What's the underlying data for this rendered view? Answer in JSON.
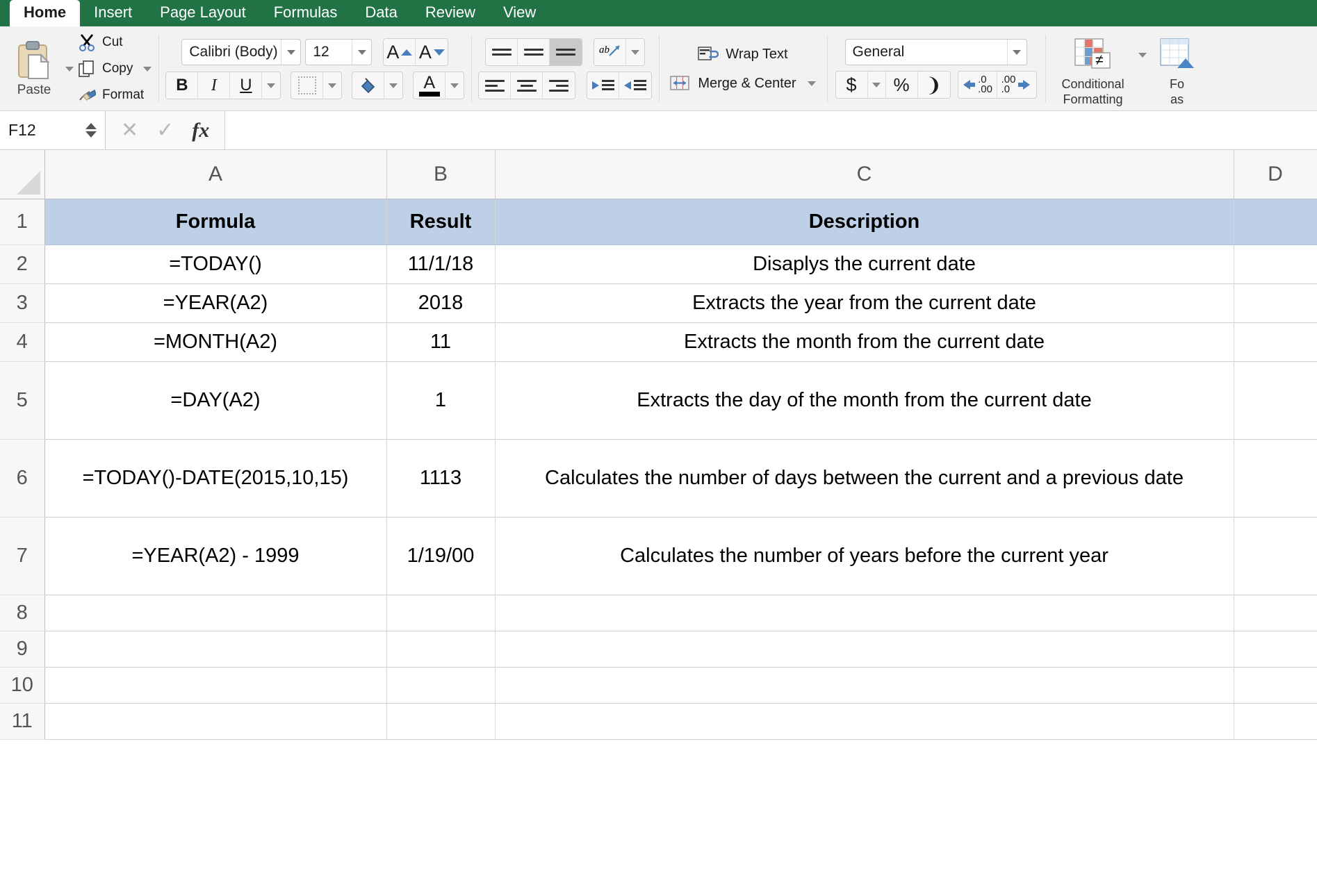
{
  "app": {
    "accent_green": "#217346",
    "header_fill": "#bdd0e7"
  },
  "ribbon_tabs": [
    {
      "label": "Home",
      "active": true
    },
    {
      "label": "Insert",
      "active": false
    },
    {
      "label": "Page Layout",
      "active": false
    },
    {
      "label": "Formulas",
      "active": false
    },
    {
      "label": "Data",
      "active": false
    },
    {
      "label": "Review",
      "active": false
    },
    {
      "label": "View",
      "active": false
    }
  ],
  "ribbon": {
    "clipboard": {
      "paste_label": "Paste",
      "cut_label": "Cut",
      "copy_label": "Copy",
      "format_label": "Format"
    },
    "font": {
      "font_name": "Calibri (Body)",
      "font_size": "12",
      "bold_label": "B",
      "italic_label": "I",
      "underline_label": "U",
      "grow_font_label": "A",
      "shrink_font_label": "A",
      "font_color_label": "A"
    },
    "alignment": {
      "wrap_text_label": "Wrap Text",
      "merge_center_label": "Merge & Center"
    },
    "number": {
      "format": "General",
      "currency_label": "$",
      "percent_label": "%",
      "comma_label": "❩",
      "decrease_decimal_label": ".00",
      "increase_decimal_label": ".0"
    },
    "styles": {
      "conditional_formatting_label": "Conditional\nFormatting",
      "conditional_formatting_line1": "Conditional",
      "conditional_formatting_line2": "Formatting",
      "format_as_table_line1": "Fo",
      "format_as_table_line2": "as"
    }
  },
  "formula_bar": {
    "name_box_value": "F12",
    "cancel_label": "✕",
    "confirm_label": "✓",
    "fx_label": "fx",
    "content": ""
  },
  "sheet": {
    "column_headers": [
      "A",
      "B",
      "C",
      "D"
    ],
    "row_numbers": [
      "1",
      "2",
      "3",
      "4",
      "5",
      "6",
      "7",
      "8",
      "9",
      "10",
      "11"
    ],
    "rows": [
      {
        "num": "1",
        "header": true,
        "a": "Formula",
        "b": "Result",
        "c": "Description",
        "d": ""
      },
      {
        "num": "2",
        "header": false,
        "a": "=TODAY()",
        "b": "11/1/18",
        "c": "Disaplys the current date",
        "d": ""
      },
      {
        "num": "3",
        "header": false,
        "a": "=YEAR(A2)",
        "b": "2018",
        "c": "Extracts the year from the current date",
        "d": ""
      },
      {
        "num": "4",
        "header": false,
        "a": "=MONTH(A2)",
        "b": "11",
        "c": "Extracts the month from the current date",
        "d": ""
      },
      {
        "num": "5",
        "header": false,
        "a": "=DAY(A2)",
        "b": "1",
        "c": "Extracts the day of the month from the current date",
        "d": ""
      },
      {
        "num": "6",
        "header": false,
        "a": "=TODAY()-DATE(2015,10,15)",
        "b": "1113",
        "c": "Calculates the number of days between the current and a previous date",
        "d": ""
      },
      {
        "num": "7",
        "header": false,
        "a": "=YEAR(A2) - 1999",
        "b": "1/19/00",
        "c": "Calculates the number of years before the current year",
        "d": ""
      },
      {
        "num": "8",
        "header": false,
        "a": "",
        "b": "",
        "c": "",
        "d": ""
      },
      {
        "num": "9",
        "header": false,
        "a": "",
        "b": "",
        "c": "",
        "d": ""
      },
      {
        "num": "10",
        "header": false,
        "a": "",
        "b": "",
        "c": "",
        "d": ""
      },
      {
        "num": "11",
        "header": false,
        "a": "",
        "b": "",
        "c": "",
        "d": ""
      }
    ]
  }
}
